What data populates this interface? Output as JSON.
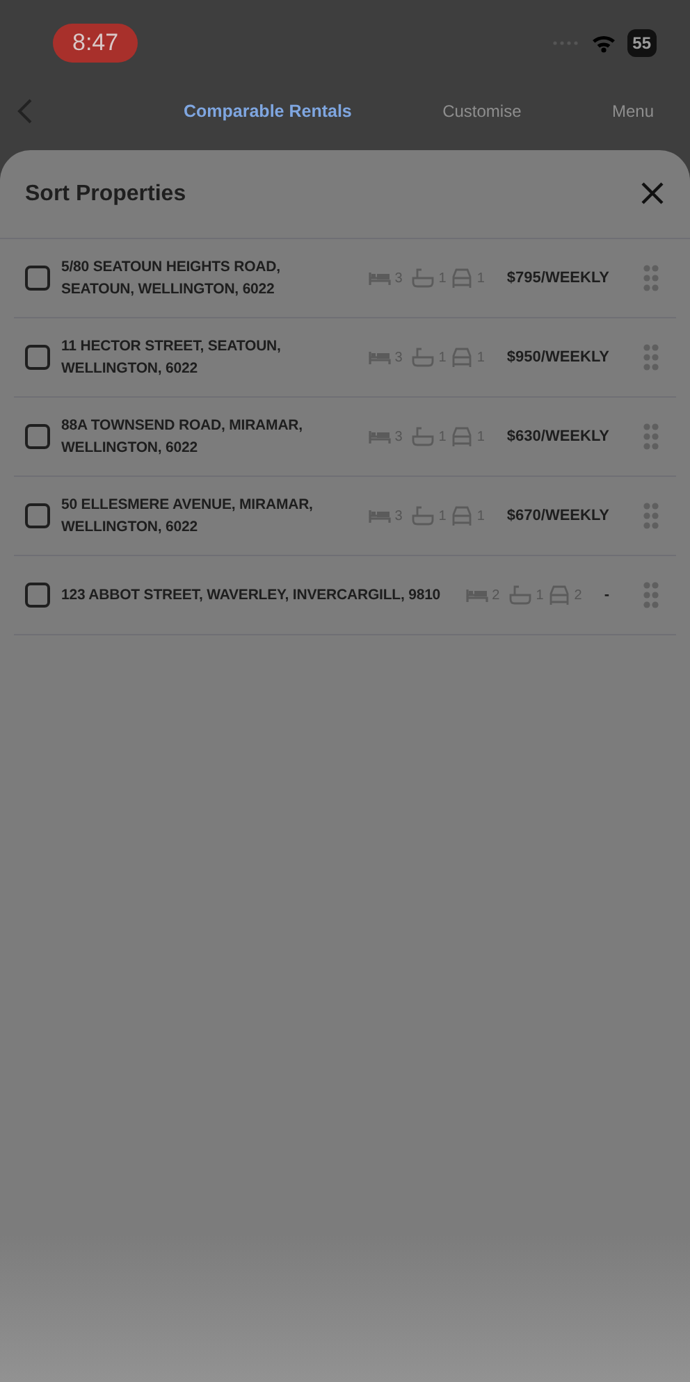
{
  "status_bar": {
    "time": "8:47",
    "battery": "55"
  },
  "nav": {
    "tabs": [
      {
        "label": "Comparable Rentals",
        "selected": true
      },
      {
        "label": "Customise",
        "selected": false
      },
      {
        "label": "Menu",
        "selected": false
      }
    ]
  },
  "sheet": {
    "title": "Sort Properties",
    "properties": [
      {
        "address": "5/80 SEATOUN HEIGHTS ROAD, SEATOUN, WELLINGTON, 6022",
        "beds": "3",
        "baths": "1",
        "cars": "1",
        "price": "$795/WEEKLY",
        "checked": false
      },
      {
        "address": "11 HECTOR STREET, SEATOUN, WELLINGTON, 6022",
        "beds": "3",
        "baths": "1",
        "cars": "1",
        "price": "$950/WEEKLY",
        "checked": false
      },
      {
        "address": "88A TOWNSEND ROAD, MIRAMAR, WELLINGTON, 6022",
        "beds": "3",
        "baths": "1",
        "cars": "1",
        "price": "$630/WEEKLY",
        "checked": false
      },
      {
        "address": "50 ELLESMERE AVENUE, MIRAMAR, WELLINGTON, 6022",
        "beds": "3",
        "baths": "1",
        "cars": "1",
        "price": "$670/WEEKLY",
        "checked": false
      },
      {
        "address": "123 ABBOT STREET, WAVERLEY, INVERCARGILL, 9810",
        "beds": "2",
        "baths": "1",
        "cars": "2",
        "price": "-",
        "checked": false
      }
    ]
  }
}
